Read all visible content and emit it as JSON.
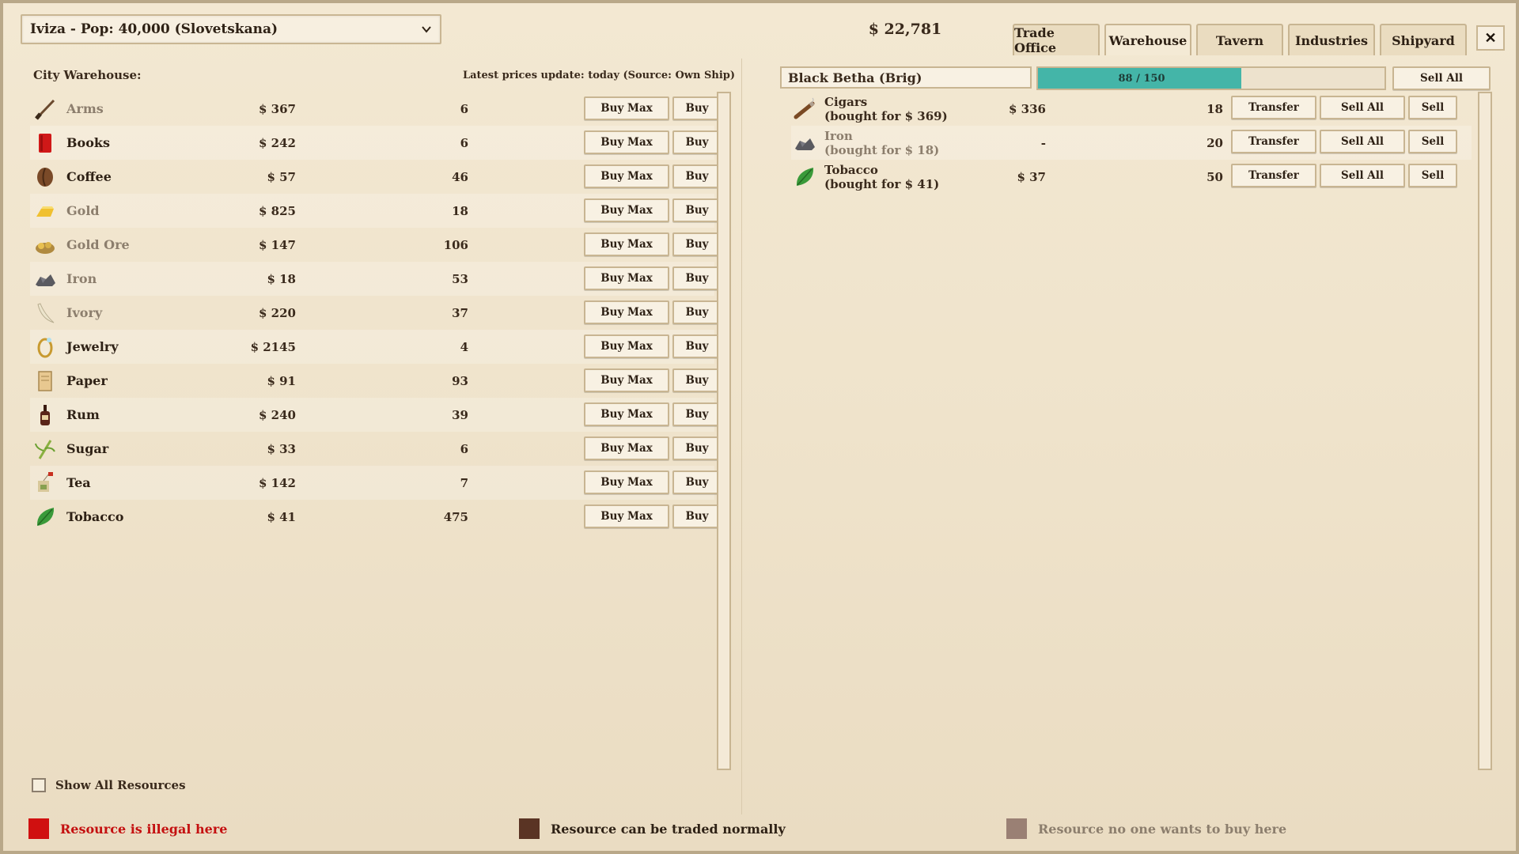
{
  "header": {
    "city_select": "Iviza - Pop: 40,000 (Slovetskana)",
    "money": "$ 22,781",
    "tabs": [
      "Trade Office",
      "Warehouse",
      "Tavern",
      "Industries",
      "Shipyard"
    ],
    "active_tab": "Warehouse",
    "close_label": "✕"
  },
  "warehouse": {
    "title": "City Warehouse:",
    "price_update": "Latest prices update: today (Source: Own Ship)",
    "buy_max_label": "Buy Max",
    "buy_label": "Buy",
    "items": [
      {
        "name": "Arms",
        "price": "$ 367",
        "qty": "6",
        "icon": "musket-icon",
        "dim": true
      },
      {
        "name": "Books",
        "price": "$ 242",
        "qty": "6",
        "icon": "book-icon",
        "dim": false
      },
      {
        "name": "Coffee",
        "price": "$ 57",
        "qty": "46",
        "icon": "coffee-bean-icon",
        "dim": false
      },
      {
        "name": "Gold",
        "price": "$ 825",
        "qty": "18",
        "icon": "gold-bar-icon",
        "dim": true
      },
      {
        "name": "Gold Ore",
        "price": "$ 147",
        "qty": "106",
        "icon": "gold-ore-icon",
        "dim": true
      },
      {
        "name": "Iron",
        "price": "$ 18",
        "qty": "53",
        "icon": "iron-ore-icon",
        "dim": true
      },
      {
        "name": "Ivory",
        "price": "$ 220",
        "qty": "37",
        "icon": "tusk-icon",
        "dim": true
      },
      {
        "name": "Jewelry",
        "price": "$ 2145",
        "qty": "4",
        "icon": "ring-icon",
        "dim": false
      },
      {
        "name": "Paper",
        "price": "$ 91",
        "qty": "93",
        "icon": "paper-icon",
        "dim": false
      },
      {
        "name": "Rum",
        "price": "$ 240",
        "qty": "39",
        "icon": "bottle-icon",
        "dim": false
      },
      {
        "name": "Sugar",
        "price": "$ 33",
        "qty": "6",
        "icon": "sugarcane-icon",
        "dim": false
      },
      {
        "name": "Tea",
        "price": "$ 142",
        "qty": "7",
        "icon": "tea-bag-icon",
        "dim": false
      },
      {
        "name": "Tobacco",
        "price": "$ 41",
        "qty": "475",
        "icon": "tobacco-leaf-icon",
        "dim": false
      }
    ],
    "show_all_label": "Show All Resources"
  },
  "ship": {
    "name": "Black Betha (Brig)",
    "cargo_text": "88 / 150",
    "cargo_fraction": 0.5867,
    "sell_all_label": "Sell All",
    "transfer_label": "Transfer",
    "sell_label": "Sell",
    "items": [
      {
        "name": "Cigars",
        "bought": "(bought for $ 369)",
        "price": "$ 336",
        "qty": "18",
        "icon": "cigar-icon",
        "dim": false
      },
      {
        "name": "Iron",
        "bought": "(bought for $ 18)",
        "price": "-",
        "qty": "20",
        "icon": "iron-ore-icon",
        "dim": true
      },
      {
        "name": "Tobacco",
        "bought": "(bought for $ 41)",
        "price": "$ 37",
        "qty": "50",
        "icon": "tobacco-leaf-icon",
        "dim": false
      }
    ]
  },
  "legend": {
    "illegal": {
      "label": "Resource is illegal here",
      "color": "#d01010"
    },
    "normal": {
      "label": "Resource can be traded normally",
      "color": "#5a3424"
    },
    "unwanted": {
      "label": "Resource no one wants to buy here",
      "color": "#9a8074"
    }
  }
}
